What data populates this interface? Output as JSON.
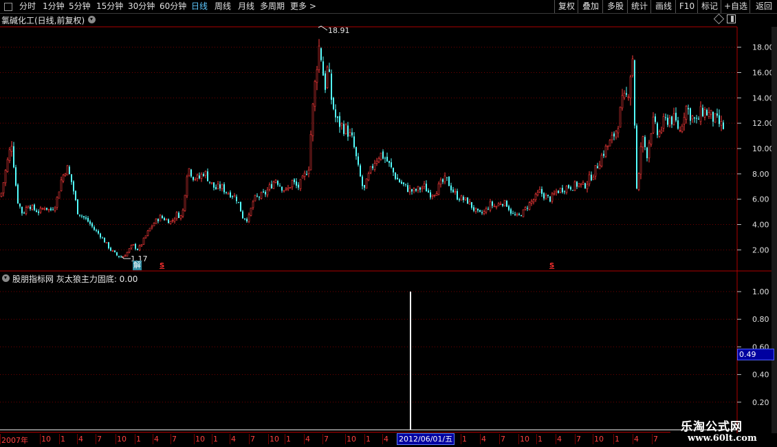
{
  "toolbar": {
    "periods": [
      "分时",
      "1分钟",
      "5分钟",
      "15分钟",
      "30分钟",
      "60分钟",
      "日线",
      "周线",
      "月线",
      "多周期",
      "更多"
    ],
    "active_period": "日线",
    "actions": [
      "复权",
      "叠加",
      "多股",
      "统计",
      "画线",
      "F10",
      "标记",
      "+自选",
      "返回"
    ]
  },
  "main_panel": {
    "title": "氯碱化工(日线,前复权)",
    "high_label": "18.91",
    "low_label": "1.17",
    "marker_jie": "解",
    "marker_s": "S",
    "y_ticks": [
      "18.00",
      "16.00",
      "14.00",
      "12.00",
      "10.00",
      "8.00",
      "6.00",
      "4.00",
      "2.00"
    ]
  },
  "indicator_panel": {
    "title": "股朋指标网 灰太狼主力固底: 0.00",
    "y_ticks": [
      "1.00",
      "0.80",
      "0.60",
      "0.40",
      "0.20"
    ],
    "readout": "0.49"
  },
  "time_axis": {
    "labels": [
      "2007年",
      "10",
      "1",
      "4",
      "7",
      "10",
      "1",
      "4",
      "7",
      "10",
      "1",
      "4",
      "7",
      "10",
      "1",
      "4",
      "7",
      "10",
      "1",
      "4",
      "7",
      "10",
      "1",
      "4",
      "7",
      "10",
      "1",
      "4",
      "7",
      "10",
      "1",
      "4",
      "7",
      "10"
    ],
    "cursor_date": "2012/06/01/五"
  },
  "watermark": {
    "line1": "乐淘公式网",
    "line2": "www.60lt.com"
  },
  "colors": {
    "up": "#ff3b3b",
    "down": "#54ffff",
    "grid": "#7a0000",
    "border": "#b00000"
  },
  "chart_data": [
    {
      "type": "candlestick",
      "title": "氯碱化工(日线,前复权)",
      "ylim": [
        0.5,
        19.5
      ],
      "annotations": [
        {
          "label": "18.91",
          "value": 18.91
        },
        {
          "label": "1.17",
          "value": 1.17
        }
      ],
      "x": [
        0,
        8,
        16,
        24,
        32,
        40,
        48,
        56,
        64,
        72,
        80,
        88,
        96,
        104,
        112,
        120,
        128,
        136,
        144,
        152,
        160,
        168,
        176,
        184,
        192,
        200,
        208,
        216,
        224,
        232,
        240,
        248,
        256,
        264,
        272,
        280,
        288,
        296,
        304,
        312,
        320,
        328,
        336,
        344,
        352,
        360,
        368,
        376,
        384,
        392,
        400,
        408,
        416,
        424,
        432,
        440,
        448,
        452,
        456,
        460,
        464,
        468,
        472,
        476,
        480,
        488,
        496,
        504,
        512,
        520,
        528,
        536,
        544,
        552,
        560,
        568,
        576,
        584,
        592,
        600,
        608,
        616,
        624,
        632,
        640,
        648,
        656,
        664,
        672,
        680,
        688,
        696,
        704,
        712,
        720,
        728,
        736,
        744,
        752,
        760,
        768,
        776,
        784,
        792,
        800,
        808,
        816,
        824,
        832,
        840,
        848,
        856,
        864,
        872,
        880,
        888,
        896,
        904,
        912,
        916,
        920,
        924,
        928,
        932,
        940,
        948,
        956,
        964,
        972,
        980,
        988,
        996,
        1004,
        1012,
        1020,
        1028,
        1036,
        1044,
        1052,
        1060,
        1068
      ],
      "close": [
        6.2,
        8.5,
        10.5,
        6.0,
        4.8,
        5.6,
        5.2,
        5.0,
        5.4,
        5.1,
        5.6,
        7.5,
        8.6,
        7.2,
        5.0,
        4.6,
        4.2,
        3.6,
        3.2,
        2.6,
        2.0,
        1.6,
        1.4,
        1.8,
        2.4,
        2.0,
        2.8,
        3.6,
        4.2,
        4.6,
        4.4,
        4.2,
        4.8,
        4.6,
        8.6,
        7.8,
        7.6,
        8.2,
        7.4,
        6.8,
        7.0,
        6.6,
        6.4,
        6.0,
        4.6,
        4.4,
        6.0,
        6.2,
        6.4,
        7.0,
        7.6,
        7.0,
        6.6,
        7.4,
        6.9,
        7.6,
        8.6,
        12.0,
        14.5,
        16.8,
        18.4,
        16.2,
        15.0,
        16.6,
        14.2,
        12.2,
        11.8,
        11.4,
        10.6,
        8.4,
        6.6,
        8.0,
        9.0,
        9.6,
        9.2,
        8.4,
        7.6,
        7.2,
        6.8,
        6.6,
        6.8,
        7.0,
        6.4,
        6.6,
        7.2,
        7.6,
        6.8,
        6.2,
        6.0,
        5.8,
        5.2,
        4.8,
        5.0,
        5.6,
        5.4,
        5.8,
        5.6,
        4.8,
        4.6,
        5.0,
        5.6,
        6.0,
        6.6,
        6.2,
        6.0,
        6.6,
        6.8,
        7.0,
        7.0,
        7.2,
        7.0,
        7.6,
        8.2,
        9.2,
        10.0,
        10.6,
        11.6,
        13.6,
        14.2,
        16.0,
        17.6,
        6.4,
        7.8,
        11.0,
        9.6,
        12.2,
        11.0,
        12.0,
        12.4,
        12.2,
        11.4,
        13.4,
        12.6,
        12.0,
        13.0,
        12.8,
        12.4,
        12.0,
        11.6
      ]
    },
    {
      "type": "bar",
      "title": "股朋指标网 灰太狼主力固底",
      "ylim": [
        0,
        1.05
      ],
      "x_spike_label": "2012/06/01/五",
      "values_note": "0.00 everywhere except single spike of 1.00",
      "spike_value": 1.0
    }
  ]
}
